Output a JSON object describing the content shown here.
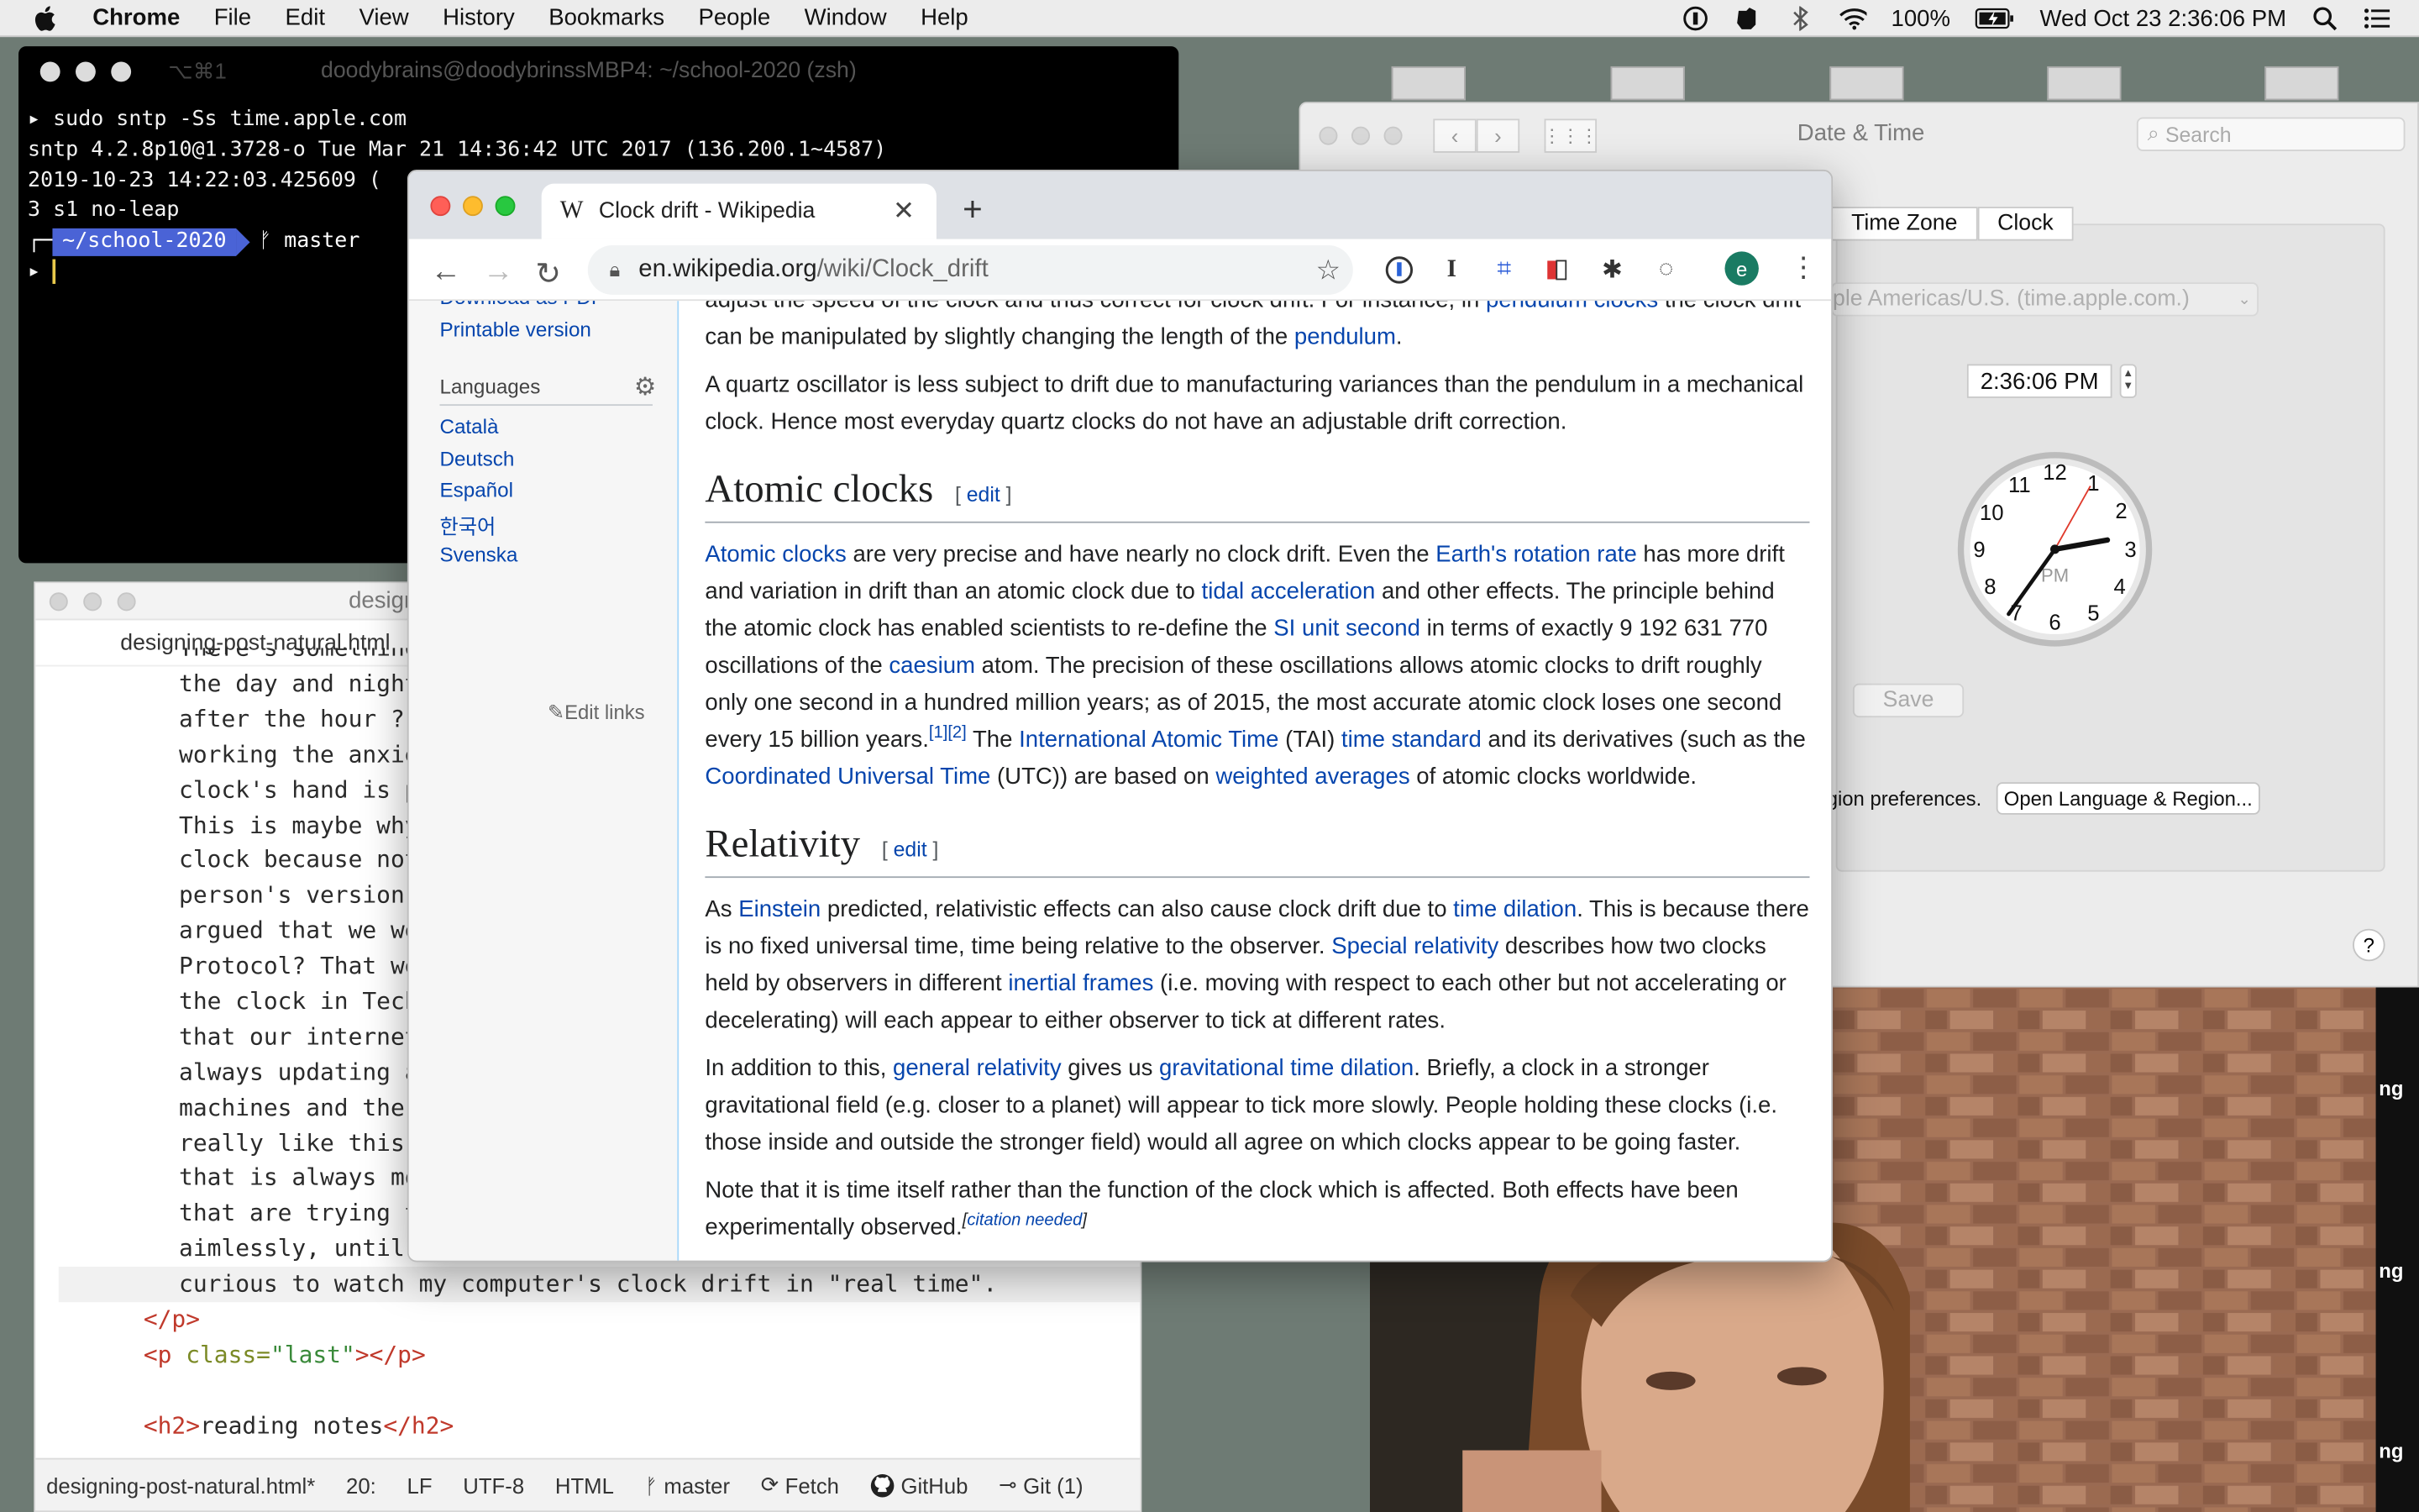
{
  "menubar": {
    "app": "Chrome",
    "items": [
      "File",
      "Edit",
      "View",
      "History",
      "Bookmarks",
      "People",
      "Window",
      "Help"
    ],
    "battery": "100%",
    "datetime": "Wed Oct 23  2:36:06 PM"
  },
  "terminal": {
    "shortcut": "⌥⌘1",
    "title": "doodybrains@doodybrinssMBP4: ~/school-2020 (zsh)",
    "lines": [
      "▸ sudo sntp -Ss time.apple.com",
      "sntp 4.2.8p10@1.3728-o Tue Mar 21 14:36:42 UTC 2017 (136.200.1~4587)",
      "2019-10-23 14:22:03.425609 (",
      "3 s1 no-leap"
    ],
    "prompt_dir": "~/school-2020",
    "prompt_branch": "ᚠ master",
    "prompt_symbol": "▸"
  },
  "editor": {
    "title": "design",
    "tab": "designing-post-natural.html",
    "lines": [
      "There's something",
      "the day and night f",
      "after the hour ? Cl",
      "working the anxiety",
      "clock's hand is pul",
      "This is maybe why i",
      "clock because not o",
      "person's version of",
      "argued that we were",
      "Protocol? That we'r",
      "the clock in Techir",
      "that our internet n",
      "always updating aga",
      "machines and the th",
      "really like this te",
      "that is always movi",
      "that are trying to ",
      "aimlessly, until something or someone comes in to update it. I'd be",
      "curious to watch my computer's clock drift in \"real time\"."
    ],
    "close_p": "</p>",
    "p_last_open": "<p ",
    "p_last_attr": "class=",
    "p_last_val": "\"last\"",
    "p_last_close": "></p>",
    "h2_open": "<h2>",
    "h2_text": "reading notes",
    "h2_close": "</h2>",
    "status": {
      "file": "designing-post-natural.html*",
      "cursor": "20:",
      "eol": "LF",
      "encoding": "UTF-8",
      "grammar": "HTML",
      "branch": "master",
      "fetch": "Fetch",
      "github": "GitHub",
      "git": "Git (1)"
    }
  },
  "prefs": {
    "title": "Date & Time",
    "search_placeholder": "Search",
    "tab_timezone": "Time Zone",
    "tab_clock": "Clock",
    "server": "ple Americas/U.S. (time.apple.com.)",
    "time": "2:36:06 PM",
    "clock_pm": "PM",
    "save": "Save",
    "region_text": "gion preferences.",
    "region_button": "Open Language & Region...",
    "help": "?"
  },
  "chrome": {
    "tab_title": "Clock drift - Wikipedia",
    "tab_favicon": "W",
    "url_domain": "en.wikipedia.org",
    "url_path": "/wiki/Clock_drift",
    "avatar": "e",
    "ext_text": "I"
  },
  "wiki": {
    "sidebar": {
      "download": "Download as PDF",
      "printable": "Printable version",
      "languages_head": "Languages",
      "languages": [
        "Català",
        "Deutsch",
        "Español",
        "한국어",
        "Svenska"
      ],
      "edit_links": "Edit links"
    },
    "p_top_1": "adjust the speed of the clock and thus correct for clock drift. For instance, in ",
    "p_top_link1": "pendulum clocks",
    "p_top_2": " the clock drift can be manipulated by slightly changing the length of the ",
    "p_top_link2": "pendulum",
    "p_top_3": ".",
    "p_quartz": "A quartz oscillator is less subject to drift due to manufacturing variances than the pendulum in a mechanical clock. Hence most everyday quartz clocks do not have an adjustable drift correction.",
    "h_atomic": "Atomic clocks",
    "edit": "edit",
    "atomic": {
      "l1": "Atomic clocks",
      "t1": " are very precise and have nearly no clock drift. Even the ",
      "l2": "Earth's rotation rate",
      "t2": " has more drift and variation in drift than an atomic clock due to ",
      "l3": "tidal acceleration",
      "t3": " and other effects. The principle behind the atomic clock has enabled scientists to re-define the ",
      "l4": "SI unit second",
      "t4": " in terms of exactly 9 192 631 770 oscillations of the ",
      "l5": "caesium",
      "t5": " atom. The precision of these oscillations allows atomic clocks to drift roughly only one second in a hundred million years; as of 2015, the most accurate atomic clock loses one second every 15 billion years.",
      "sup": "[1][2]",
      "t6": " The ",
      "l6": "International Atomic Time",
      "t7": " (TAI) ",
      "l7": "time standard",
      "t8": " and its derivatives (such as the ",
      "l8": "Coordinated Universal Time",
      "t9": " (UTC)) are based on ",
      "l9": "weighted averages",
      "t10": " of atomic clocks worldwide."
    },
    "h_relativity": "Relativity",
    "rel1": {
      "t1": "As ",
      "l1": "Einstein",
      "t2": " predicted, relativistic effects can also cause clock drift due to ",
      "l2": "time dilation",
      "t3": ". This is because there is no fixed universal time, time being relative to the observer. ",
      "l3": "Special relativity",
      "t4": " describes how two clocks held by observers in different ",
      "l4": "inertial frames",
      "t5": " (i.e. moving with respect to each other but not accelerating or decelerating) will each appear to either observer to tick at different rates."
    },
    "rel2": {
      "t1": "In addition to this, ",
      "l1": "general relativity",
      "t2": " gives us ",
      "l2": "gravitational time dilation",
      "t3": ". Briefly, a clock in a stronger gravitational field (e.g. closer to a planet) will appear to tick more slowly. People holding these clocks (i.e. those inside and outside the stronger field) would all agree on which clocks appear to be going faster."
    },
    "rel3": "Note that it is time itself rather than the function of the clock which is affected. Both effects have been experimentally observed.",
    "citation": "citation needed"
  },
  "video_side_labels": [
    "ng",
    "ng",
    "ng"
  ],
  "colors": {
    "wiki_link": "#0645ad",
    "chrome_tabbar": "#dee1e6",
    "terminal_prompt": "#4a63d6"
  }
}
